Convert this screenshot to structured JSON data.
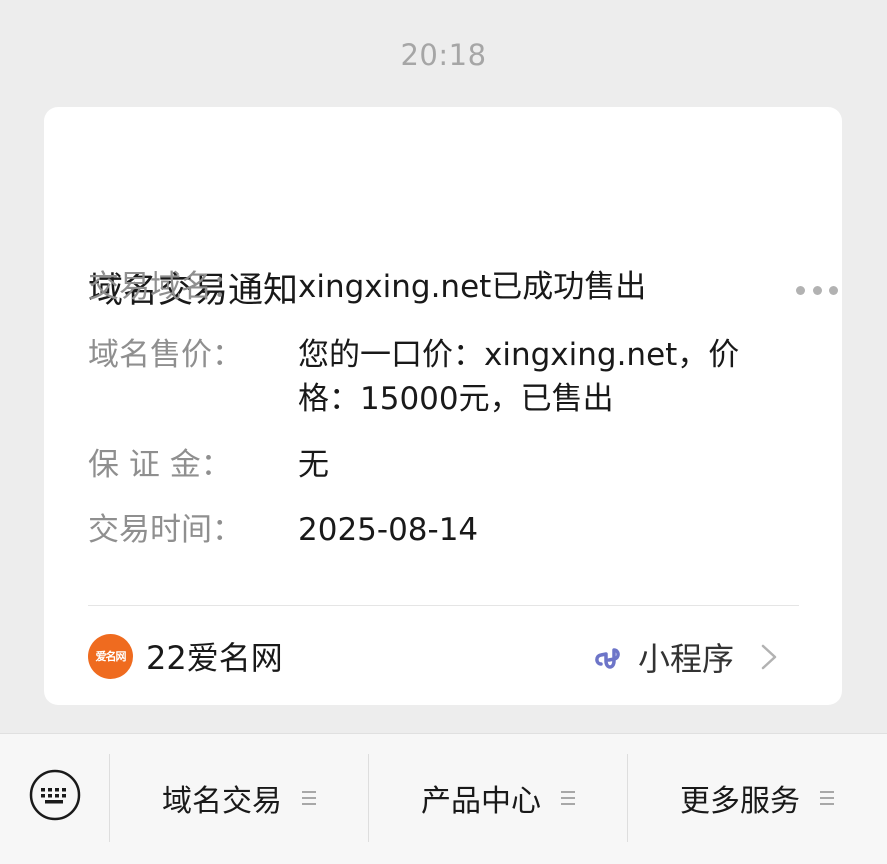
{
  "timestamp": "20:18",
  "card": {
    "title": "域名交易通知",
    "rows": [
      {
        "label": "交易域名：",
        "value": "xingxing.net已成功售出"
      },
      {
        "label": "域名售价：",
        "value": "您的一口价：xingxing.net，价格：15000元，已售出"
      },
      {
        "label": "保 证 金：",
        "value": "无"
      },
      {
        "label": "交易时间：",
        "value": "2025-08-14"
      }
    ],
    "source": {
      "logo_text": "爱名网",
      "name": "22爱名网"
    },
    "mini_program_label": "小程序"
  },
  "bottom_menu": {
    "items": [
      {
        "label": "域名交易"
      },
      {
        "label": "产品中心"
      },
      {
        "label": "更多服务"
      }
    ]
  },
  "colors": {
    "background": "#ededed",
    "card": "#ffffff",
    "label_gray": "#8f8f8f",
    "logo_orange": "#ef6b1f",
    "mini_program_icon": "#6d75c8"
  },
  "icons": {
    "more": "more-dots-icon",
    "mini_program": "mini-program-icon",
    "chevron": "chevron-right-icon",
    "keyboard": "keyboard-icon",
    "menu": "menu-lines-icon"
  }
}
